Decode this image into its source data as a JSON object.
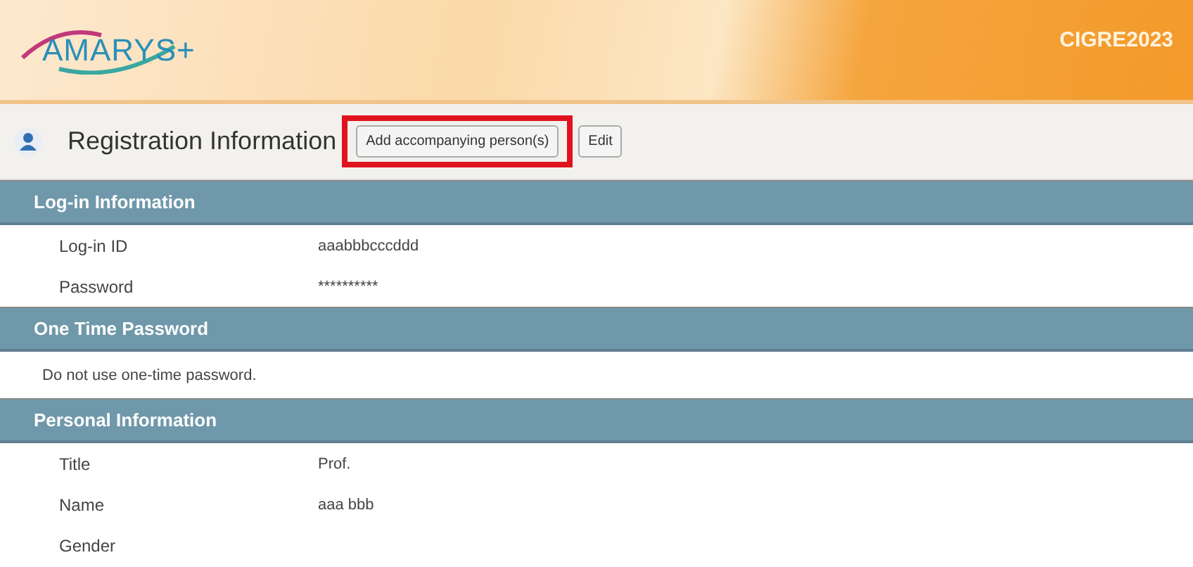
{
  "header": {
    "logo": "AMARYS+",
    "event": "CIGRE2023"
  },
  "page_title": "Registration Information",
  "buttons": [
    {
      "label": "Add accompanying person(s)",
      "highlighted": true
    },
    {
      "label": "Edit",
      "highlighted": false
    }
  ],
  "sections": [
    {
      "title": "Log-in Information",
      "rows": [
        {
          "kind": "field",
          "label": "Log-in ID",
          "value": "aaabbbcccddd"
        },
        {
          "kind": "field",
          "label": "Password",
          "value": "**********"
        }
      ]
    },
    {
      "title": "One Time Password",
      "rows": [
        {
          "kind": "note",
          "text": "Do not use one-time password."
        }
      ]
    },
    {
      "title": "Personal Information",
      "rows": [
        {
          "kind": "field",
          "label": "Title",
          "value": "Prof."
        },
        {
          "kind": "field",
          "label": "Name",
          "value": "aaa bbb"
        },
        {
          "kind": "field",
          "label": "Gender"
        }
      ]
    }
  ]
}
